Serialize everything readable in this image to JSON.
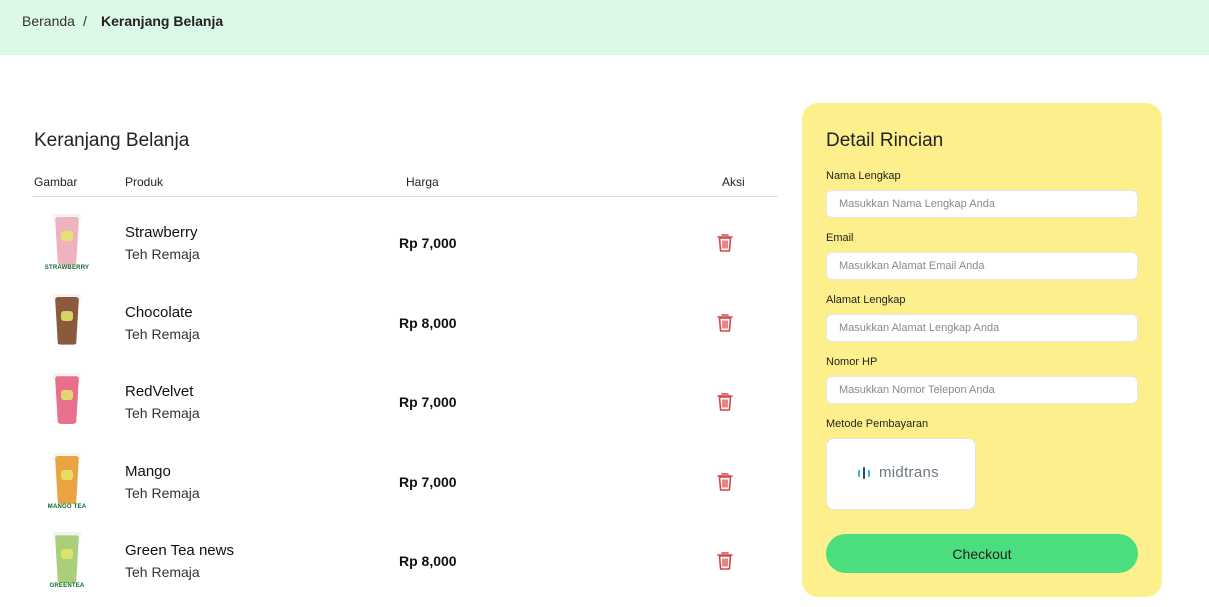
{
  "breadcrumb": {
    "home": "Beranda",
    "separator": "/",
    "current": "Keranjang Belanja"
  },
  "cart": {
    "title": "Keranjang Belanja",
    "headers": {
      "image": "Gambar",
      "product": "Produk",
      "price": "Harga",
      "action": "Aksi"
    },
    "items": [
      {
        "name": "Strawberry",
        "store": "Teh Remaja",
        "price": "Rp 7,000",
        "thumb_label": "STRAWBERRY",
        "color": "#efb3bf",
        "icon": "trash-icon"
      },
      {
        "name": "Chocolate",
        "store": "Teh Remaja",
        "price": "Rp 8,000",
        "thumb_label": "",
        "color": "#8a5a3c",
        "icon": "trash-icon"
      },
      {
        "name": "RedVelvet",
        "store": "Teh Remaja",
        "price": "Rp 7,000",
        "thumb_label": "",
        "color": "#e8708c",
        "icon": "trash-icon"
      },
      {
        "name": "Mango",
        "store": "Teh Remaja",
        "price": "Rp 7,000",
        "thumb_label": "MANGO TEA",
        "color": "#e9a441",
        "icon": "trash-icon"
      },
      {
        "name": "Green Tea news",
        "store": "Teh Remaja",
        "price": "Rp 8,000",
        "thumb_label": "GREENTEA",
        "color": "#a9cf7a",
        "icon": "trash-icon"
      }
    ]
  },
  "detail": {
    "title": "Detail Rincian",
    "fields": {
      "name": {
        "label": "Nama Lengkap",
        "placeholder": "Masukkan Nama Lengkap Anda",
        "value": ""
      },
      "email": {
        "label": "Email",
        "placeholder": "Masukkan Alamat Email Anda",
        "value": ""
      },
      "address": {
        "label": "Alamat Lengkap",
        "placeholder": "Masukkan Alamat Lengkap Anda",
        "value": ""
      },
      "phone": {
        "label": "Nomor HP",
        "placeholder": "Masukkan Nomor Telepon Anda",
        "value": ""
      }
    },
    "payment": {
      "label": "Metode Pembayaran",
      "option": "midtrans",
      "icon": "midtrans-logo-icon"
    },
    "checkout_label": "Checkout"
  },
  "colors": {
    "topbar_bg": "#dcf8e6",
    "panel_bg": "#fdf08c",
    "checkout_bg": "#4ade7e",
    "delete_icon": "#d64545"
  }
}
